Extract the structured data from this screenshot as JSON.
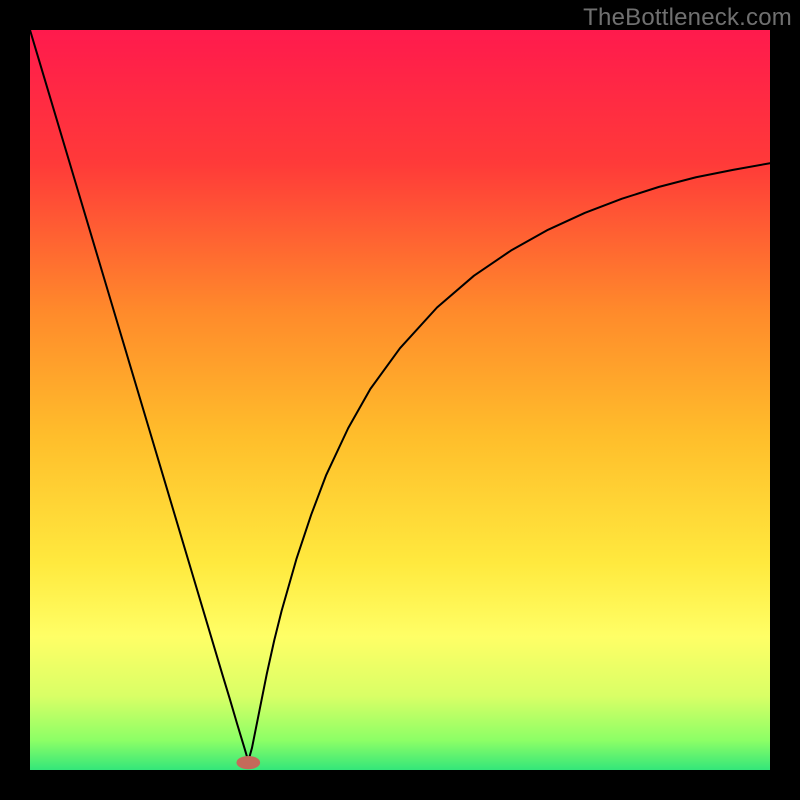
{
  "watermark": "TheBottleneck.com",
  "chart_data": {
    "type": "line",
    "title": "",
    "xlabel": "",
    "ylabel": "",
    "xlim": [
      0,
      100
    ],
    "ylim": [
      0,
      100
    ],
    "grid": false,
    "background": {
      "stops": [
        {
          "offset": 0,
          "color": "#ff1a4d"
        },
        {
          "offset": 18,
          "color": "#ff3a39"
        },
        {
          "offset": 38,
          "color": "#ff8a2b"
        },
        {
          "offset": 55,
          "color": "#ffbe2b"
        },
        {
          "offset": 72,
          "color": "#ffe93e"
        },
        {
          "offset": 82,
          "color": "#ffff66"
        },
        {
          "offset": 90,
          "color": "#d9ff66"
        },
        {
          "offset": 96,
          "color": "#8cff66"
        },
        {
          "offset": 100,
          "color": "#33e67a"
        }
      ]
    },
    "marker": {
      "x": 29.5,
      "y": 1.0,
      "rx": 1.6,
      "ry": 0.9,
      "color": "#c46a5a"
    },
    "series": [
      {
        "name": "curve",
        "color": "#000000",
        "width": 2,
        "x": [
          0,
          2,
          4,
          6,
          8,
          10,
          12,
          14,
          16,
          18,
          20,
          22,
          24,
          26,
          27,
          28,
          29,
          29.5,
          30,
          31,
          32,
          33,
          34,
          36,
          38,
          40,
          43,
          46,
          50,
          55,
          60,
          65,
          70,
          75,
          80,
          85,
          90,
          95,
          100
        ],
        "y": [
          100,
          93.3,
          86.6,
          79.9,
          73.2,
          66.5,
          59.8,
          53.1,
          46.4,
          39.7,
          33.0,
          26.3,
          19.6,
          12.9,
          9.6,
          6.2,
          2.9,
          1.2,
          3.0,
          8.0,
          13.0,
          17.5,
          21.5,
          28.5,
          34.5,
          39.8,
          46.2,
          51.5,
          57.0,
          62.5,
          66.8,
          70.2,
          73.0,
          75.3,
          77.2,
          78.8,
          80.1,
          81.1,
          82.0
        ]
      }
    ]
  }
}
